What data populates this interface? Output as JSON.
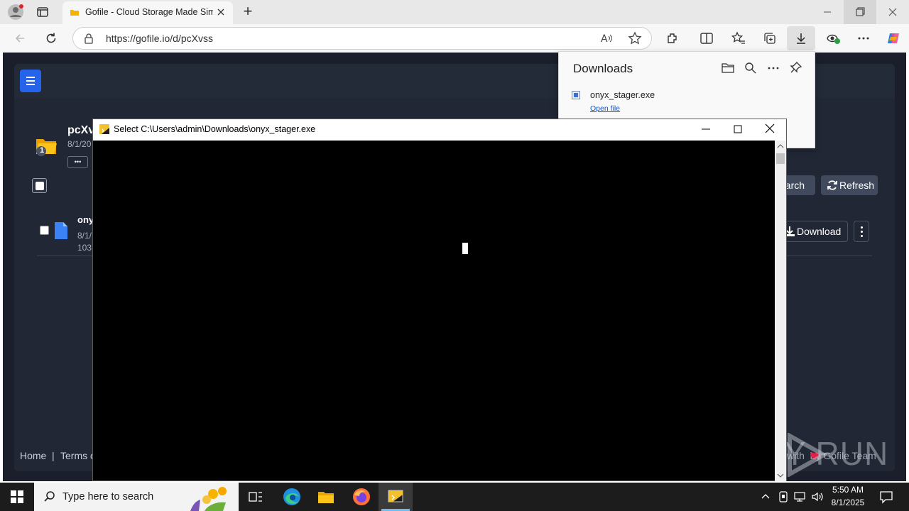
{
  "browser": {
    "tab_title": "Gofile - Cloud Storage Made Simple",
    "new_tab_label": "+",
    "url": "https://gofile.io/d/pcXvss"
  },
  "downloads": {
    "title": "Downloads",
    "file_name": "onyx_stager.exe",
    "open_file": "Open file"
  },
  "page": {
    "folder_name": "pcXv",
    "folder_date": "8/1/20",
    "folder_badge": "1",
    "more_label": "•••",
    "search_label": "earch",
    "refresh_label": "Refresh",
    "file_name": "ony",
    "file_date": "8/1/",
    "file_size": "103.",
    "download_label": "Download",
    "footer_home": "Home",
    "footer_sep": "|",
    "footer_terms": "Terms c",
    "footer_right": "with  by Gofile Team",
    "watermark": "ANY RUN"
  },
  "console": {
    "title": "Select C:\\Users\\admin\\Downloads\\onyx_stager.exe"
  },
  "taskbar": {
    "search_placeholder": "Type here to search",
    "time": "5:50 AM",
    "date": "8/1/2025"
  }
}
